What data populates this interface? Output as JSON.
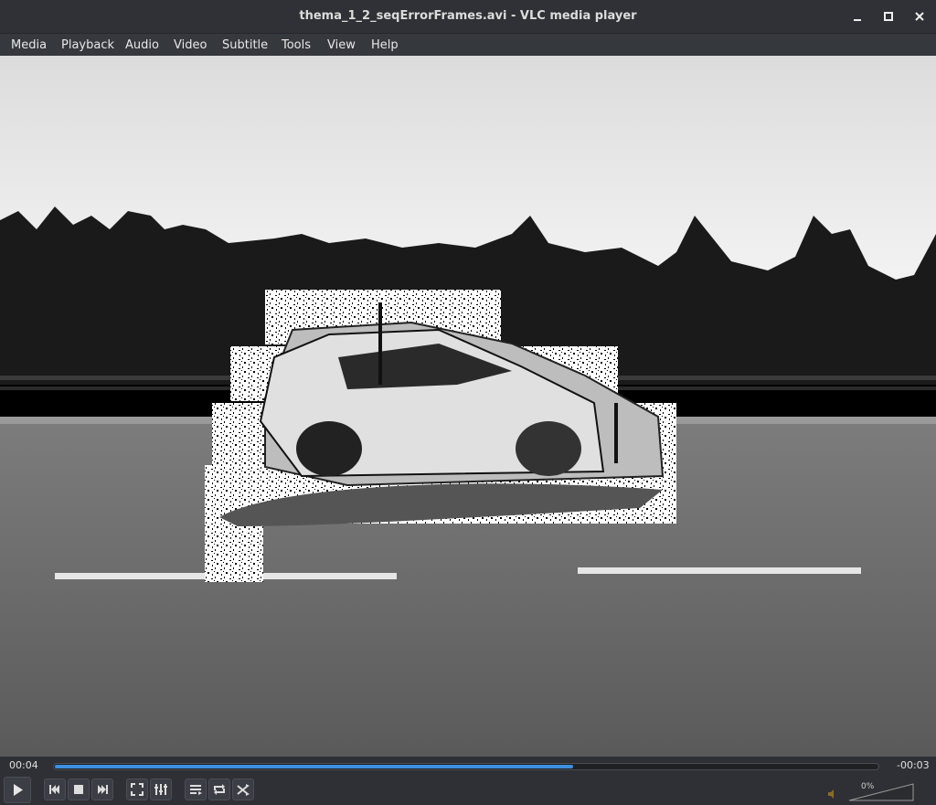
{
  "window": {
    "title": "thema_1_2_seqErrorFrames.avi - VLC media player",
    "minimize_icon": "minimize-icon",
    "maximize_icon": "maximize-icon",
    "close_icon": "close-icon"
  },
  "menu": {
    "items": [
      "Media",
      "Playback",
      "Audio",
      "Video",
      "Subtitle",
      "Tools",
      "View",
      "Help"
    ]
  },
  "playback": {
    "elapsed": "00:04",
    "remaining": "-00:03",
    "progress_fraction": 0.63
  },
  "volume": {
    "percent_label": "0%",
    "level_fraction": 0.0
  },
  "controls": {
    "play_icon": "play-icon",
    "previous_icon": "previous-icon",
    "stop_icon": "stop-icon",
    "next_icon": "next-icon",
    "fullscreen_icon": "fullscreen-icon",
    "extended_settings_icon": "equalizer-icon",
    "playlist_icon": "playlist-icon",
    "loop_icon": "loop-icon",
    "shuffle_icon": "shuffle-icon",
    "mute_icon": "speaker-icon"
  },
  "colors": {
    "accent": "#3d8fe0"
  }
}
